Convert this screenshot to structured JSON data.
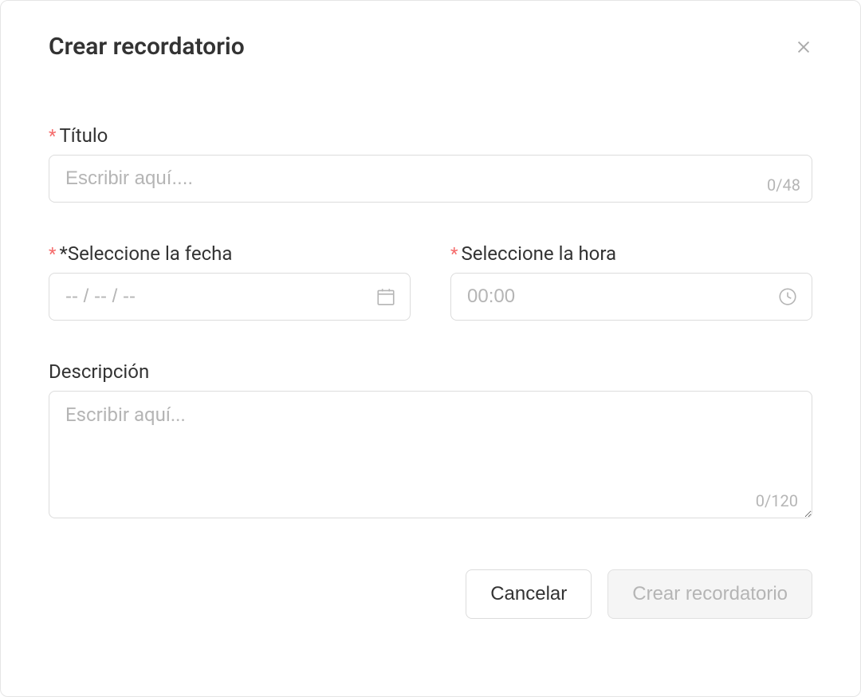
{
  "modal": {
    "title": "Crear recordatorio"
  },
  "form": {
    "title": {
      "label": "Título",
      "placeholder": "Escribir aquí....",
      "counter": "0/48"
    },
    "date": {
      "label": "*Seleccione la fecha",
      "placeholder": "-- / -- / --"
    },
    "time": {
      "label": "Seleccione la hora",
      "placeholder": "00:00"
    },
    "description": {
      "label": "Descripción",
      "placeholder": "Escribir aquí...",
      "counter": "0/120"
    }
  },
  "buttons": {
    "cancel": "Cancelar",
    "create": "Crear recordatorio"
  }
}
